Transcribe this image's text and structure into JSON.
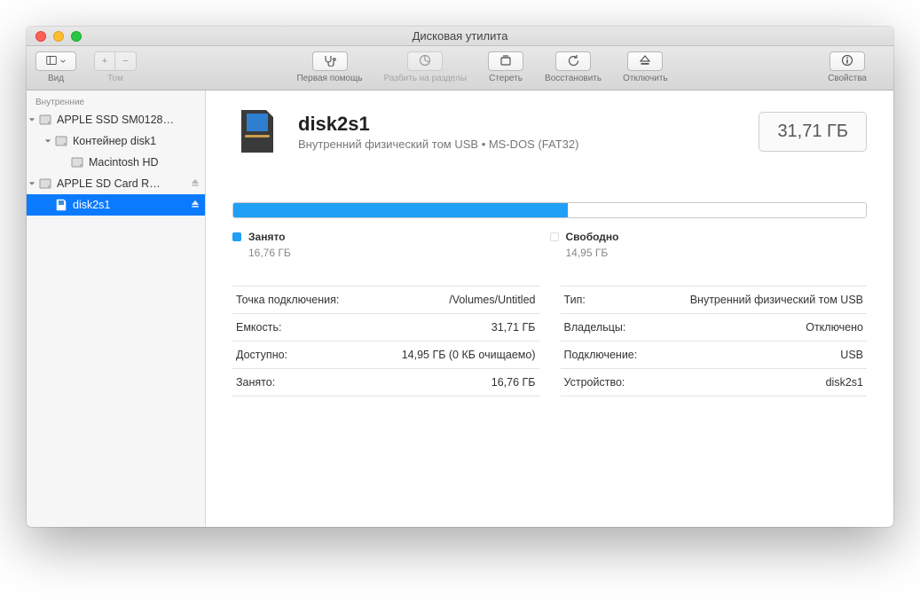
{
  "window": {
    "title": "Дисковая утилита"
  },
  "toolbar": {
    "view_label": "Вид",
    "volume_label": "Том",
    "firstaid_label": "Первая помощь",
    "partition_label": "Разбить на разделы",
    "erase_label": "Стереть",
    "restore_label": "Восстановить",
    "unmount_label": "Отключить",
    "info_label": "Свойства"
  },
  "sidebar": {
    "header": "Внутренние",
    "items": [
      {
        "label": "APPLE SSD SM0128…"
      },
      {
        "label": "Контейнер disk1"
      },
      {
        "label": "Macintosh HD"
      },
      {
        "label": "APPLE SD Card R…"
      },
      {
        "label": "disk2s1"
      }
    ]
  },
  "header": {
    "title": "disk2s1",
    "subtitle": "Внутренний физический том USB • MS-DOS (FAT32)",
    "size": "31,71 ГБ"
  },
  "usage": {
    "used_label": "Занято",
    "used_value": "16,76 ГБ",
    "free_label": "Свободно",
    "free_value": "14,95 ГБ",
    "used_percent": 52.9
  },
  "left_table": [
    {
      "k": "Точка подключения:",
      "v": "/Volumes/Untitled"
    },
    {
      "k": "Емкость:",
      "v": "31,71 ГБ"
    },
    {
      "k": "Доступно:",
      "v": "14,95 ГБ (0 КБ очищаемо)"
    },
    {
      "k": "Занято:",
      "v": "16,76 ГБ"
    }
  ],
  "right_table": [
    {
      "k": "Тип:",
      "v": "Внутренний физический том USB"
    },
    {
      "k": "Владельцы:",
      "v": "Отключено"
    },
    {
      "k": "Подключение:",
      "v": "USB"
    },
    {
      "k": "Устройство:",
      "v": "disk2s1"
    }
  ]
}
